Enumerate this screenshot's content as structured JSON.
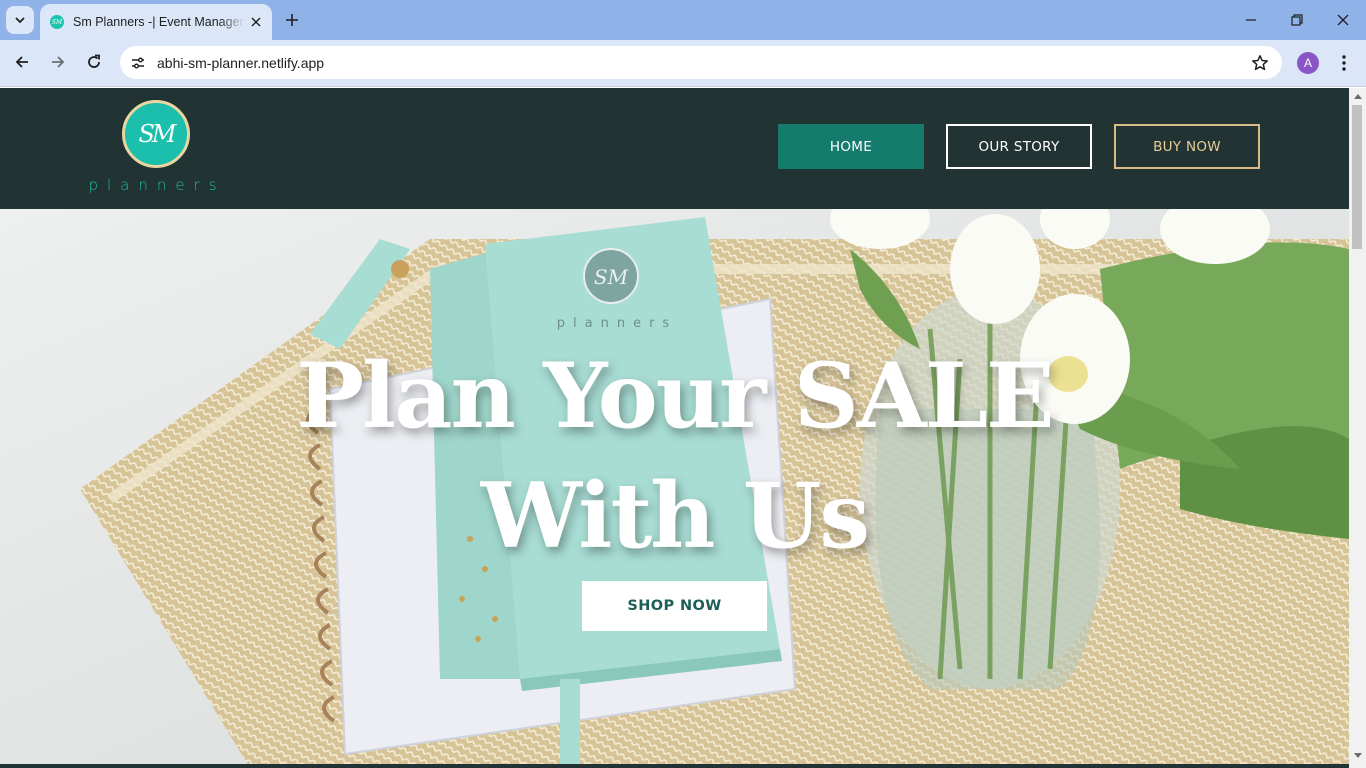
{
  "browser": {
    "tab_title": "Sm Planners -| Event Management",
    "favicon_text": "SM",
    "url": "abhi-sm-planner.netlify.app",
    "profile_initial": "A"
  },
  "header": {
    "logo_monogram": "SM",
    "logo_wordmark": "planners",
    "nav": {
      "home": "HOME",
      "story": "OUR STORY",
      "buy": "BUY NOW"
    }
  },
  "hero": {
    "title_line1": "Plan Your SALE",
    "title_line2": "With Us",
    "cta": "SHOP NOW",
    "product_monogram": "SM",
    "product_wordmark": "planners"
  },
  "colors": {
    "header_bg": "#213433",
    "accent_teal": "#157b6d",
    "gold": "#d8bb84",
    "browser_frame": "#8fb2e8"
  },
  "icons": [
    "tab-search-icon",
    "close-icon",
    "plus-icon",
    "minimize-icon",
    "restore-icon",
    "back-icon",
    "forward-icon",
    "reload-icon",
    "site-info-icon",
    "star-icon",
    "more-menu-icon"
  ]
}
